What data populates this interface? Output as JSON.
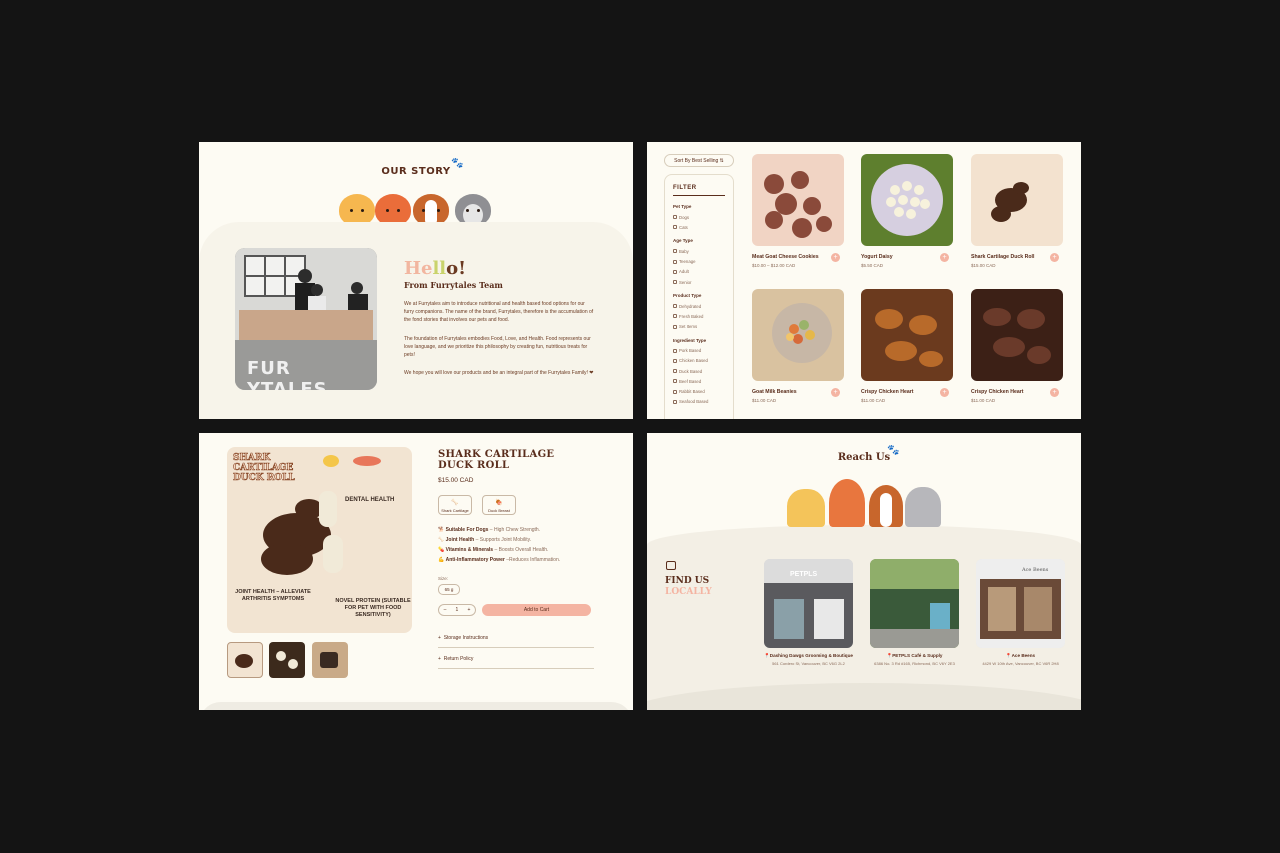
{
  "story": {
    "title": "OUR STORY",
    "hello_1": "He",
    "hello_2": "ll",
    "hello_3": "o!",
    "from_team": "From Furrytales Team",
    "para1": "We at Furrytales aim to introduce nutritional and health based food options for our furry companions. The name of the brand, Furrytales, therefore is the accumulation of the fond stories that involves our pets and food.",
    "para2": "The foundation of Furrytales embodies Food, Love, and Health. Food represents our love language, and we prioritize this philosophy by creating fun, nutritious treats for pets!",
    "para3": "We hope you will love our products and be an integral part of the Furrytales Family! ❤",
    "banner_text": "FUR YTALES"
  },
  "shop": {
    "sort_label": "Sort By Best Selling  ⇅",
    "filter_title": "FILTER",
    "groups": [
      {
        "title": "Pet Type",
        "options": [
          "Dogs",
          "Cats"
        ]
      },
      {
        "title": "Age Type",
        "options": [
          "Baby",
          "Teenage",
          "Adult",
          "Senior"
        ]
      },
      {
        "title": "Product Type",
        "options": [
          "Dehydrated",
          "Fresh Baked",
          "Set Items"
        ]
      },
      {
        "title": "Ingredient Type",
        "options": [
          "Pork Based",
          "Chicken Based",
          "Duck Based",
          "Beef Based",
          "Rabbit Based",
          "Seafood Based"
        ]
      }
    ],
    "products": [
      {
        "name": "Meat Goat Cheese Cookies",
        "price": "$10.00 – $12.00 CAD"
      },
      {
        "name": "Yogurt Daisy",
        "price": "$5.50 CAD"
      },
      {
        "name": "Shark Cartilage Duck Roll",
        "price": "$15.00 CAD"
      },
      {
        "name": "Goat Milk Beanies",
        "price": "$11.00 CAD"
      },
      {
        "name": "Crispy Chicken Heart",
        "price": "$11.00 CAD"
      },
      {
        "name": "Crispy Chicken Heart",
        "price": "$11.00 CAD"
      }
    ]
  },
  "product": {
    "image_title": "SHARK CARTILAGE DUCK ROLL",
    "callout_1": "DENTAL HEALTH",
    "callout_2": "JOINT HEALTH – ALLEVIATE ARTHRITIS SYMPTOMS",
    "callout_3": "NOVEL PROTEIN (SUITABLE FOR PET WITH FOOD SENSITIVITY)",
    "title": "SHARK CARTILAGE DUCK ROLL",
    "price": "$15.00 CAD",
    "variant_1": "Shark Cartilage",
    "variant_2": "Duck Breast",
    "benefits": [
      {
        "icon": "🐕",
        "bold": "Suitable For Dogs",
        "text": " – High Chew Strength."
      },
      {
        "icon": "🦴",
        "bold": "Joint Health",
        "text": " – Supports Joint Mobility."
      },
      {
        "icon": "💊",
        "bold": "Vitamins & Minerals",
        "text": " – Boosts Overall Health."
      },
      {
        "icon": "💪",
        "bold": "Anti-Inflammatory Power",
        "text": " –Reduces Inflammation."
      }
    ],
    "size_label": "Size:",
    "size_value": "65 g",
    "qty_minus": "–",
    "qty_value": "1",
    "qty_plus": "+",
    "add_to_cart": "Add to Cart",
    "accordion_1": "Storage Instructions",
    "accordion_2": "Return Policy"
  },
  "reach": {
    "title": "Reach Us",
    "find_1": "FIND US",
    "find_2": "LOCALLY",
    "stores": [
      {
        "name": "📍Dashing Dawgs Grooming & Boutique",
        "address": "561 Cordero St, Vancouver, BC V6G 2L2",
        "sign": "PETPLS"
      },
      {
        "name": "📍PETPLS Café & Supply",
        "address": "6386 No. 3 Rd #165, Richmond, BC V6Y 2E3",
        "sign": ""
      },
      {
        "name": "📍Ace Beens",
        "address": "4429 W 10th Ave, Vancouver, BC V6R 2H8",
        "sign": "Ace Beens"
      }
    ]
  }
}
